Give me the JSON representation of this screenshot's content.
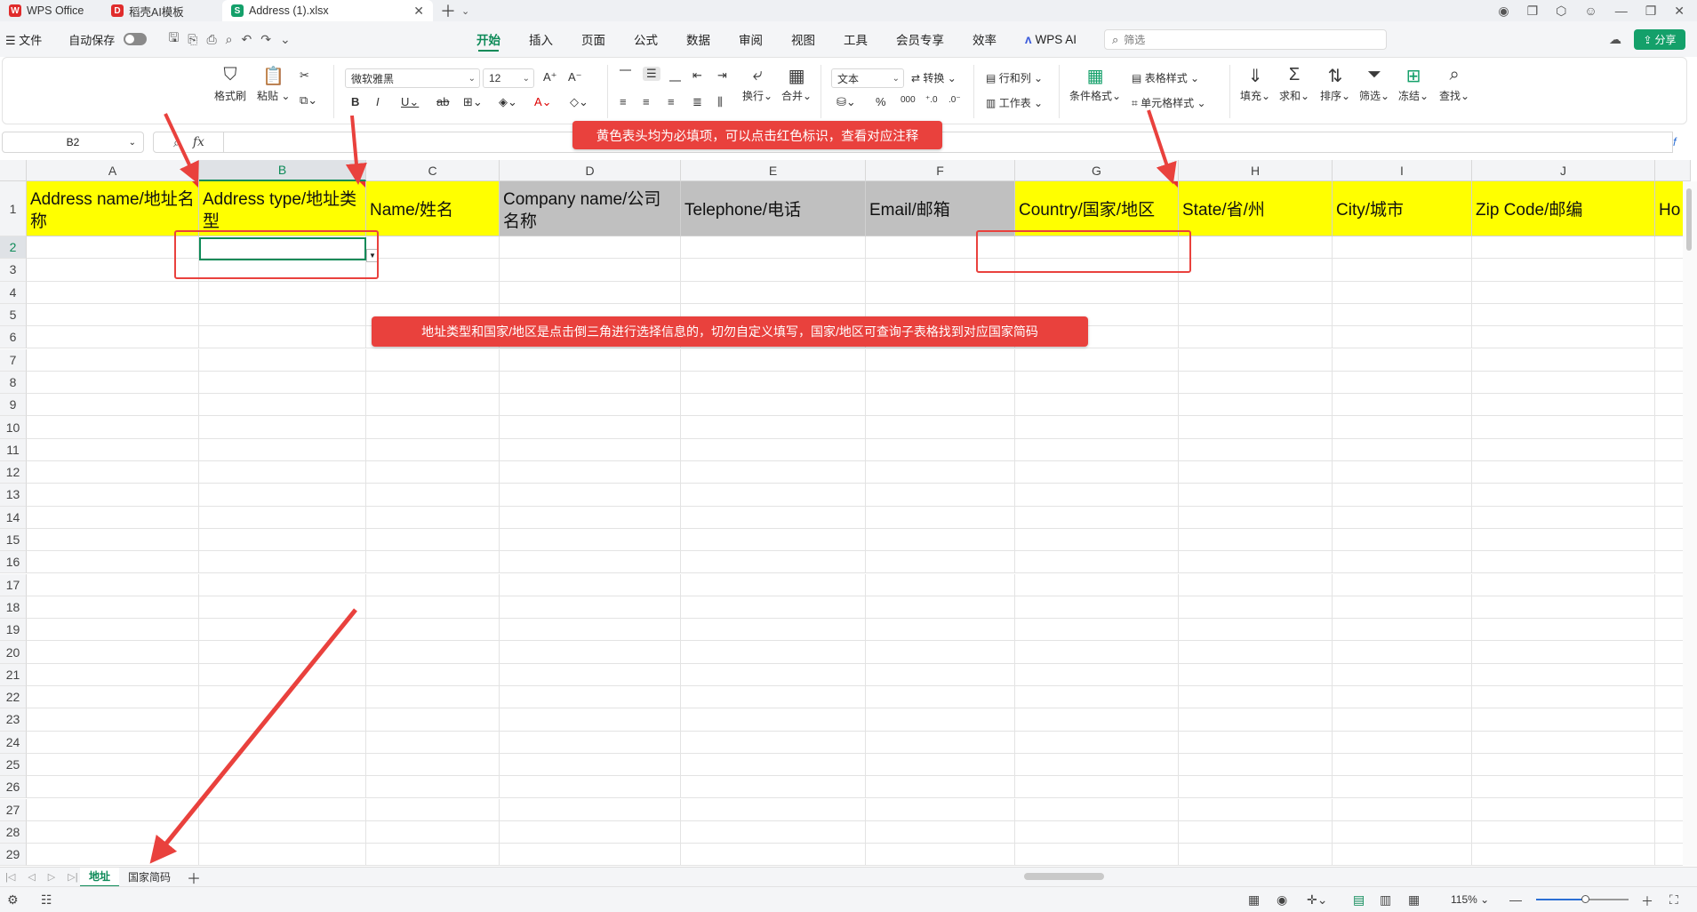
{
  "tabs": [
    {
      "label": "WPS Office",
      "icon": "W",
      "color": "#e02c2c"
    },
    {
      "label": "稻壳AI模板",
      "icon": "D",
      "color": "#e02c2c"
    },
    {
      "label": "Address (1).xlsx",
      "icon": "S",
      "color": "#14a06a"
    }
  ],
  "menu": {
    "file_label": "文件",
    "autosave_label": "自动保存",
    "tabs": [
      "开始",
      "插入",
      "页面",
      "公式",
      "数据",
      "审阅",
      "视图",
      "工具",
      "会员专享",
      "效率"
    ],
    "wps_ai": "WPS AI",
    "search_placeholder": "筛选",
    "share_label": "分享"
  },
  "ribbon": {
    "format_painter": "格式刷",
    "paste": "粘贴",
    "font_name": "微软雅黑",
    "font_size": "12",
    "wrap": "换行",
    "merge": "合并",
    "number_format": "文本",
    "convert": "转换",
    "rows_cols": "行和列",
    "worksheet": "工作表",
    "cond_format": "条件格式",
    "table_style": "表格样式",
    "cell_style": "单元格样式",
    "fill": "填充",
    "sum": "求和",
    "sort": "排序",
    "filter": "筛选",
    "freeze": "冻结",
    "find": "查找"
  },
  "formula_bar": {
    "cell_ref": "B2",
    "fx_label": "fx",
    "value": ""
  },
  "grid": {
    "columns": [
      "A",
      "B",
      "C",
      "D",
      "E",
      "F",
      "G",
      "H",
      "I",
      "J"
    ],
    "selected_column": "B",
    "rows": [
      "1",
      "2",
      "3",
      "4",
      "5",
      "6",
      "7",
      "8",
      "9",
      "10",
      "11",
      "12",
      "13",
      "14",
      "15",
      "16",
      "17",
      "18",
      "19",
      "20",
      "21",
      "22",
      "23",
      "24",
      "25",
      "26",
      "27",
      "28",
      "29"
    ],
    "headers": [
      {
        "text": "Address name/地址名称",
        "fill": "yellow",
        "comment": true
      },
      {
        "text": "Address type/地址类型",
        "fill": "yellow",
        "comment": true
      },
      {
        "text": "Name/姓名",
        "fill": "yellow",
        "comment": false
      },
      {
        "text": "Company name/公司名称",
        "fill": "gray",
        "comment": false
      },
      {
        "text": "Telephone/电话",
        "fill": "gray",
        "comment": false
      },
      {
        "text": "Email/邮箱",
        "fill": "gray",
        "comment": false
      },
      {
        "text": "Country/国家/地区",
        "fill": "yellow",
        "comment": true
      },
      {
        "text": "State/省/州",
        "fill": "yellow",
        "comment": false
      },
      {
        "text": "City/城市",
        "fill": "yellow",
        "comment": false
      },
      {
        "text": "Zip Code/邮编",
        "fill": "yellow",
        "comment": false
      },
      {
        "text": "Ho",
        "fill": "yellow",
        "comment": false
      }
    ]
  },
  "annotations": {
    "top_note": "黄色表头均为必填项，可以点击红色标识，查看对应注释",
    "middle_note": "地址类型和国家/地区是点击倒三角进行选择信息的，切勿自定义填写，国家/地区可查询子表格找到对应国家简码"
  },
  "sheets": [
    {
      "label": "地址",
      "active": true
    },
    {
      "label": "国家简码",
      "active": false
    }
  ],
  "status": {
    "zoom": "115%"
  },
  "colors": {
    "accent": "#0d8a58",
    "required_header": "#ffff00",
    "optional_header": "#c0c0c0",
    "annotation": "#e9413d"
  }
}
